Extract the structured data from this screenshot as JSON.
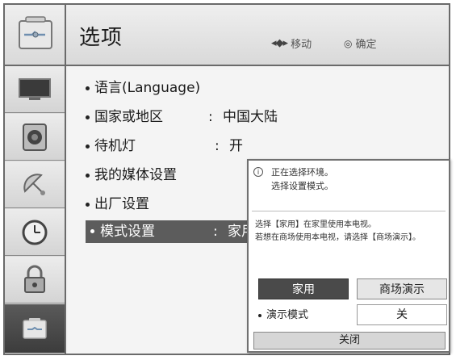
{
  "header": {
    "title": "选项",
    "move_hint": "移动",
    "ok_hint": "确定",
    "icon": "options-toolbox-icon"
  },
  "sidebar": {
    "items": [
      {
        "icon": "picture-tv-icon"
      },
      {
        "icon": "sound-speaker-icon"
      },
      {
        "icon": "channel-satellite-icon"
      },
      {
        "icon": "time-clock-icon"
      },
      {
        "icon": "lock-icon"
      },
      {
        "icon": "options-toolbox-icon",
        "active": true
      }
    ]
  },
  "options": {
    "language": "语言(Language)",
    "country_label": "国家或地区",
    "country_value": "中国大陆",
    "standby_label": "待机灯",
    "standby_value": "开",
    "media_label": "我的媒体设置",
    "factory_label": "出厂设置",
    "mode_label": "模式设置",
    "mode_value": "家用",
    "colon": ":"
  },
  "dialog": {
    "line1": "正在选择环境。",
    "line2": "选择设置模式。",
    "desc1": "选择【家用】在家里使用本电视。",
    "desc2": "若想在商场使用本电视，请选择【商场演示】。",
    "home_button": "家用",
    "store_button": "商场演示",
    "demo_label": "演示模式",
    "demo_value": "关",
    "close_button": "关闭"
  },
  "colors": {
    "selected_bg": "#5c5c5c",
    "panel_bg": "#f2f2f2",
    "border": "#6a6a6a"
  }
}
